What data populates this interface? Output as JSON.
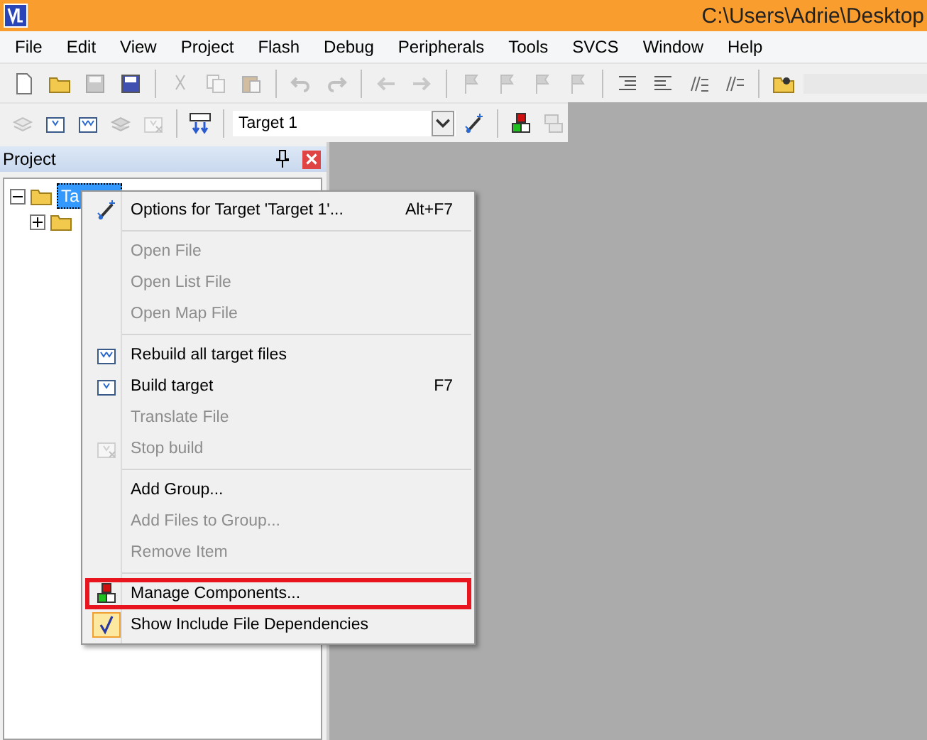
{
  "window": {
    "title": "C:\\Users\\Adrie\\Desktop"
  },
  "menu_bar": [
    "File",
    "Edit",
    "View",
    "Project",
    "Flash",
    "Debug",
    "Peripherals",
    "Tools",
    "SVCS",
    "Window",
    "Help"
  ],
  "toolbar_2": {
    "target_select": {
      "value": "Target 1"
    }
  },
  "project_panel": {
    "title": "Project",
    "tree": [
      {
        "label": "Ta",
        "selected": true,
        "expanded": true,
        "children": [
          {
            "expanded": false
          }
        ]
      }
    ]
  },
  "context_menu": [
    {
      "kind": "item",
      "label": "Options for Target 'Target 1'...",
      "shortcut": "Alt+F7",
      "disabled": false,
      "highlighted": false
    },
    {
      "kind": "separator"
    },
    {
      "kind": "item",
      "label": "Open File",
      "disabled": true,
      "highlighted": false
    },
    {
      "kind": "item",
      "label": "Open List File",
      "disabled": true,
      "highlighted": false
    },
    {
      "kind": "item",
      "label": "Open Map File",
      "disabled": true,
      "highlighted": false
    },
    {
      "kind": "separator"
    },
    {
      "kind": "item",
      "label": "Rebuild all target files",
      "disabled": false,
      "highlighted": false
    },
    {
      "kind": "item",
      "label": "Build target",
      "shortcut": "F7",
      "disabled": false,
      "highlighted": false
    },
    {
      "kind": "item",
      "label": "Translate File",
      "disabled": true,
      "highlighted": false
    },
    {
      "kind": "item",
      "label": "Stop build",
      "disabled": true,
      "highlighted": false
    },
    {
      "kind": "separator"
    },
    {
      "kind": "item",
      "label": "Add Group...",
      "disabled": false,
      "highlighted": false
    },
    {
      "kind": "item",
      "label": "Add Files to Group...",
      "disabled": true,
      "highlighted": false
    },
    {
      "kind": "item",
      "label": "Remove Item",
      "disabled": true,
      "highlighted": false
    },
    {
      "kind": "separator"
    },
    {
      "kind": "item",
      "label": "Manage Components...",
      "disabled": false,
      "highlighted": true
    },
    {
      "kind": "item",
      "label": "Show Include File Dependencies",
      "disabled": false,
      "highlighted": false,
      "checked": true
    }
  ]
}
